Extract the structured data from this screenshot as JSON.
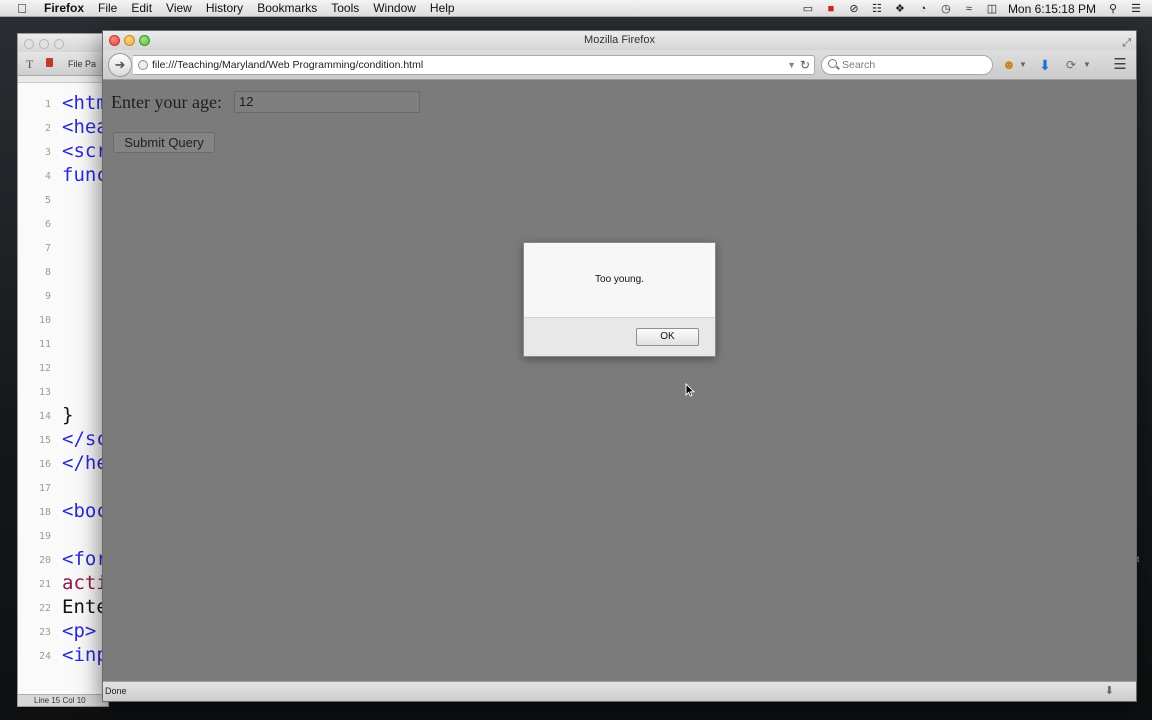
{
  "menubar": {
    "app_name": "Firefox",
    "menus": [
      "File",
      "Edit",
      "View",
      "History",
      "Bookmarks",
      "Tools",
      "Window",
      "Help"
    ],
    "clock": "Mon 6:15:18 PM"
  },
  "editor": {
    "toolbar_label": "File Pa",
    "lines": [
      {
        "num": "1",
        "text": "<htm",
        "color": "#2b2bd6"
      },
      {
        "num": "2",
        "text": "<hea",
        "color": "#2b2bd6"
      },
      {
        "num": "3",
        "text": "<scr",
        "color": "#2b2bd6"
      },
      {
        "num": "4",
        "text": "func",
        "color": "#2b2bd6"
      },
      {
        "num": "5",
        "text": "",
        "color": "#111111"
      },
      {
        "num": "6",
        "text": "",
        "color": "#111111"
      },
      {
        "num": "7",
        "text": "",
        "color": "#111111"
      },
      {
        "num": "8",
        "text": "",
        "color": "#111111"
      },
      {
        "num": "9",
        "text": "",
        "color": "#111111"
      },
      {
        "num": "10",
        "text": "",
        "color": "#111111"
      },
      {
        "num": "11",
        "text": "",
        "color": "#111111"
      },
      {
        "num": "12",
        "text": "",
        "color": "#111111"
      },
      {
        "num": "13",
        "text": "",
        "color": "#111111"
      },
      {
        "num": "14",
        "text": "}",
        "color": "#111111"
      },
      {
        "num": "15",
        "text": "</sc",
        "color": "#2b2bd6"
      },
      {
        "num": "16",
        "text": "</he",
        "color": "#2b2bd6"
      },
      {
        "num": "17",
        "text": "",
        "color": "#111111"
      },
      {
        "num": "18",
        "text": "<boc",
        "color": "#2b2bd6"
      },
      {
        "num": "19",
        "text": "",
        "color": "#111111"
      },
      {
        "num": "20",
        "text": "<for",
        "color": "#2b2bd6"
      },
      {
        "num": "21",
        "text": "acti",
        "color": "#8b1a4a"
      },
      {
        "num": "22",
        "text": "Ente",
        "color": "#111111"
      },
      {
        "num": "23",
        "text": "<p>",
        "color": "#2b2bd6"
      },
      {
        "num": "24",
        "text": "<inp",
        "color": "#2b2bd6"
      }
    ],
    "status": "Line 15 Col 10"
  },
  "firefox": {
    "window_title": "Mozilla Firefox",
    "url": "file:///Teaching/Maryland/Web Programming/condition.html",
    "search_placeholder": "Search",
    "status_text": "Done",
    "page": {
      "age_label": "Enter your age:",
      "age_value": "12",
      "submit_label": "Submit Query"
    }
  },
  "alert": {
    "message": "Too young.",
    "ok_label": "OK"
  },
  "icons": {
    "apple": "apple-icon",
    "back": "back-arrow-icon",
    "reload": "reload-icon",
    "search": "search-icon",
    "download": "download-arrow-icon",
    "menu": "hamburger-menu-icon"
  }
}
